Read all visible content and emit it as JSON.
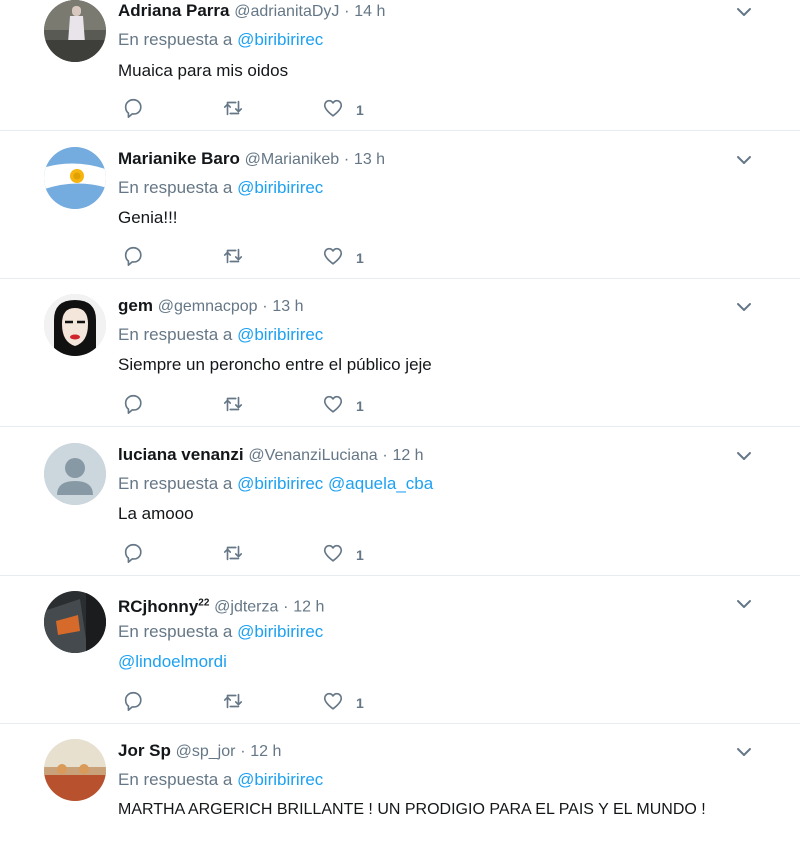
{
  "tweets": [
    {
      "name": "Adriana Parra",
      "handle": "@adrianitaDyJ",
      "dot": "·",
      "time": "14 h",
      "reply_prefix": "En respuesta a",
      "mentions": [
        "@biribirirec"
      ],
      "text": "Muaica para mis oidos",
      "likes": "1",
      "avatar": "photo-person-standing"
    },
    {
      "name": "Marianike Baro",
      "handle": "@Marianikeb",
      "dot": "·",
      "time": "13 h",
      "reply_prefix": "En respuesta a",
      "mentions": [
        "@biribirirec"
      ],
      "text": "Genia!!!",
      "likes": "1",
      "avatar": "argentina-flag"
    },
    {
      "name": "gem",
      "handle": "@gemnacpop",
      "dot": "·",
      "time": "13 h",
      "reply_prefix": "En respuesta a",
      "mentions": [
        "@biribirirec"
      ],
      "text": "Siempre un peroncho entre el público jeje",
      "likes": "1",
      "avatar": "pop-art-face"
    },
    {
      "name": "luciana venanzi",
      "handle": "@VenanziLuciana",
      "dot": "·",
      "time": "12 h",
      "reply_prefix": "En respuesta a",
      "mentions": [
        "@biribirirec",
        "@aquela_cba"
      ],
      "text": "La amooo",
      "likes": "1",
      "avatar": "default-profile"
    },
    {
      "name": "RCjhonny",
      "name_sup": "22",
      "handle": "@jdterza",
      "dot": "·",
      "time": "12 h",
      "reply_prefix": "En respuesta a",
      "mentions": [
        "@biribirirec"
      ],
      "text_mention": "@lindoelmordi",
      "likes": "1",
      "avatar": "dark-photo"
    },
    {
      "name": "Jor Sp",
      "handle": "@sp_jor",
      "dot": "·",
      "time": "12 h",
      "reply_prefix": "En respuesta a",
      "mentions": [
        "@biribirirec"
      ],
      "text": "MARTHA ARGERICH BRILLANTE ! UN PRODIGIO PARA EL PAIS Y EL MUNDO !",
      "avatar": "stage-photo"
    }
  ],
  "icons": {
    "reply": "reply-icon",
    "retweet": "retweet-icon",
    "like": "heart-icon",
    "menu": "chevron-down-icon"
  },
  "colors": {
    "link": "#1da1f2",
    "muted": "#657786",
    "text": "#14171a",
    "divider": "#e6ecf0"
  }
}
